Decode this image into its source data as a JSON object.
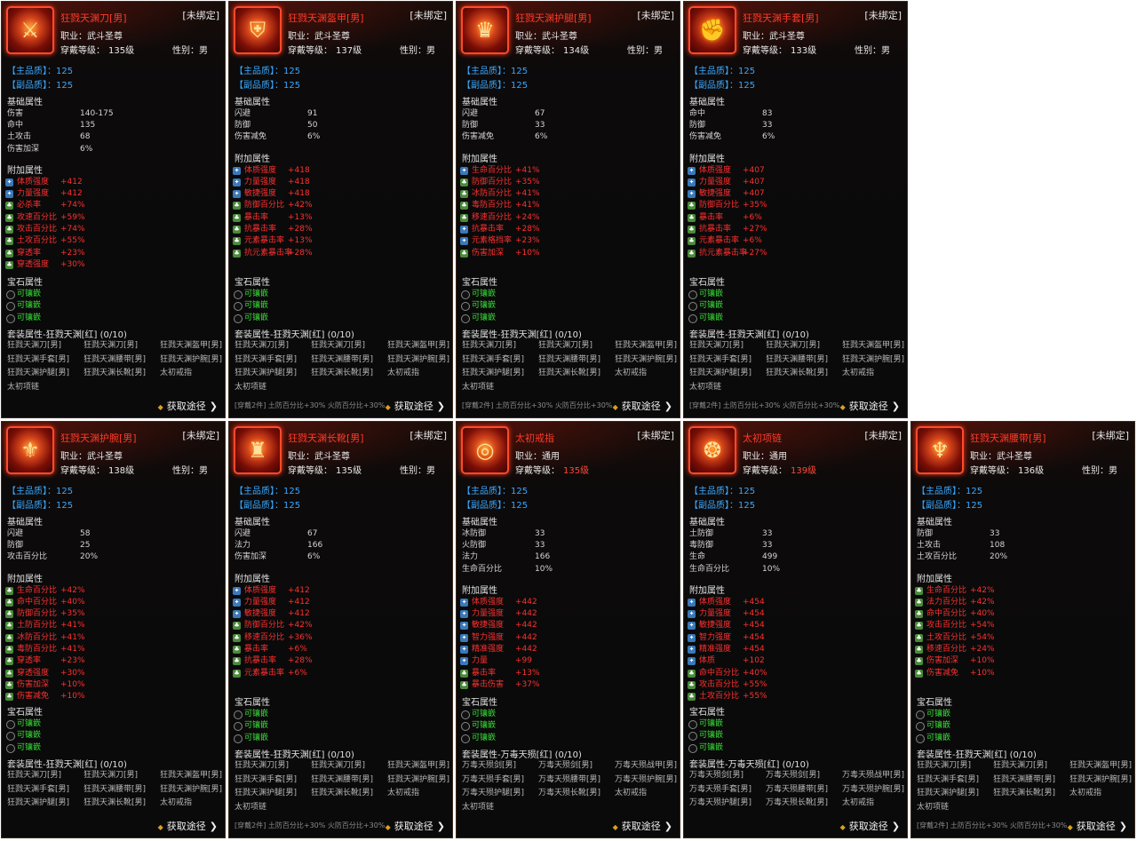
{
  "ui": {
    "unbound": "[未绑定]",
    "job_prefix": "职业：",
    "level_prefix": "穿戴等级：",
    "sex_prefix": "性别：",
    "main_quality_prefix": "【主品质】：",
    "sub_quality_prefix": "【副品质】：",
    "base_title": "基础属性",
    "add_title": "附加属性",
    "gem_title": "宝石属性",
    "gem_slot": "可镶嵌",
    "get_label": "获取途径"
  },
  "cards": [
    {
      "name": "狂戮天渊刀[男]",
      "job": "武斗圣尊",
      "level": "135级",
      "level_red": false,
      "sex": "男",
      "main_q": "125",
      "sub_q": "125",
      "icon": "sword-icon",
      "glyph": "⚔",
      "base": [
        {
          "k": "伤害",
          "v": "140-175"
        },
        {
          "k": "命中",
          "v": "135"
        },
        {
          "k": "土攻击",
          "v": "68"
        },
        {
          "k": "伤害加深",
          "v": "6%"
        }
      ],
      "add": [
        {
          "k": "体质强度",
          "v": "+412",
          "c": "blue"
        },
        {
          "k": "力量强度",
          "v": "+412",
          "c": "blue"
        },
        {
          "k": "必杀率",
          "v": "+74%",
          "c": "green"
        },
        {
          "k": "攻速百分比",
          "v": "+59%",
          "c": "green"
        },
        {
          "k": "攻击百分比",
          "v": "+74%",
          "c": "green"
        },
        {
          "k": "土攻百分比",
          "v": "+55%",
          "c": "green"
        },
        {
          "k": "穿透率",
          "v": "+23%",
          "c": "green"
        },
        {
          "k": "穿透强度",
          "v": "+30%",
          "c": "green"
        }
      ],
      "set_title": "套装属性-狂戮天渊[红] (0/10)",
      "set": [
        [
          "狂戮天渊刀[男]",
          "狂戮天渊刀[男]",
          "狂戮天渊盔甲[男]"
        ],
        [
          "狂戮天渊手套[男]",
          "狂戮天渊腰带[男]",
          "狂戮天渊护腕[男]"
        ],
        [
          "狂戮天渊护腿[男]",
          "狂戮天渊长靴[男]",
          "太初戒指"
        ],
        [
          "太初项链"
        ]
      ],
      "foot": ""
    },
    {
      "name": "狂戮天渊盔甲[男]",
      "job": "武斗圣尊",
      "level": "137级",
      "level_red": false,
      "sex": "男",
      "main_q": "125",
      "sub_q": "125",
      "icon": "armor-icon",
      "glyph": "⛨",
      "base": [
        {
          "k": "闪避",
          "v": "91"
        },
        {
          "k": "防御",
          "v": "50"
        },
        {
          "k": "伤害减免",
          "v": "6%"
        }
      ],
      "add": [
        {
          "k": "体质强度",
          "v": "+418",
          "c": "blue"
        },
        {
          "k": "力量强度",
          "v": "+418",
          "c": "blue"
        },
        {
          "k": "敏捷强度",
          "v": "+418",
          "c": "blue"
        },
        {
          "k": "防御百分比",
          "v": "+42%",
          "c": "green"
        },
        {
          "k": "暴击率",
          "v": "+13%",
          "c": "green"
        },
        {
          "k": "抗暴击率",
          "v": "+28%",
          "c": "green"
        },
        {
          "k": "元素暴击率",
          "v": "+13%",
          "c": "green"
        },
        {
          "k": "抗元素暴击率",
          "v": "+28%",
          "c": "green"
        }
      ],
      "set_title": "套装属性-狂戮天渊[红] (0/10)",
      "set": [
        [
          "狂戮天渊刀[男]",
          "狂戮天渊刀[男]",
          "狂戮天渊盔甲[男]"
        ],
        [
          "狂戮天渊手套[男]",
          "狂戮天渊腰带[男]",
          "狂戮天渊护腕[男]"
        ],
        [
          "狂戮天渊护腿[男]",
          "狂戮天渊长靴[男]",
          "太初戒指"
        ],
        [
          "太初项链"
        ]
      ],
      "foot": "[穿戴2件]  土防百分比+30%    火防百分比+30%"
    },
    {
      "name": "狂戮天渊护腿[男]",
      "job": "武斗圣尊",
      "level": "134级",
      "level_red": false,
      "sex": "男",
      "main_q": "125",
      "sub_q": "125",
      "icon": "greaves-icon",
      "glyph": "♛",
      "base": [
        {
          "k": "闪避",
          "v": "67"
        },
        {
          "k": "防御",
          "v": "33"
        },
        {
          "k": "伤害减免",
          "v": "6%"
        }
      ],
      "add": [
        {
          "k": "生命百分比",
          "v": "+41%",
          "c": "blue"
        },
        {
          "k": "防御百分比",
          "v": "+35%",
          "c": "green"
        },
        {
          "k": "冰防百分比",
          "v": "+41%",
          "c": "green"
        },
        {
          "k": "毒防百分比",
          "v": "+41%",
          "c": "green"
        },
        {
          "k": "移速百分比",
          "v": "+24%",
          "c": "green"
        },
        {
          "k": "抗暴击率",
          "v": "+28%",
          "c": "blue"
        },
        {
          "k": "元素格挡率",
          "v": "+23%",
          "c": "blue"
        },
        {
          "k": "伤害加深",
          "v": "+10%",
          "c": "green"
        }
      ],
      "set_title": "套装属性-狂戮天渊[红] (0/10)",
      "set": [
        [
          "狂戮天渊刀[男]",
          "狂戮天渊刀[男]",
          "狂戮天渊盔甲[男]"
        ],
        [
          "狂戮天渊手套[男]",
          "狂戮天渊腰带[男]",
          "狂戮天渊护腕[男]"
        ],
        [
          "狂戮天渊护腿[男]",
          "狂戮天渊长靴[男]",
          "太初戒指"
        ],
        [
          "太初项链"
        ]
      ],
      "foot": "[穿戴2件]  土防百分比+30%    火防百分比+30%"
    },
    {
      "name": "狂戮天渊手套[男]",
      "job": "武斗圣尊",
      "level": "133级",
      "level_red": false,
      "sex": "男",
      "main_q": "125",
      "sub_q": "125",
      "icon": "gauntlet-icon",
      "glyph": "✊",
      "base": [
        {
          "k": "命中",
          "v": "83"
        },
        {
          "k": "防御",
          "v": "33"
        },
        {
          "k": "伤害减免",
          "v": "6%"
        }
      ],
      "add": [
        {
          "k": "体质强度",
          "v": "+407",
          "c": "blue"
        },
        {
          "k": "力量强度",
          "v": "+407",
          "c": "blue"
        },
        {
          "k": "敏捷强度",
          "v": "+407",
          "c": "blue"
        },
        {
          "k": "防御百分比",
          "v": "+35%",
          "c": "green"
        },
        {
          "k": "暴击率",
          "v": "+6%",
          "c": "green"
        },
        {
          "k": "抗暴击率",
          "v": "+27%",
          "c": "green"
        },
        {
          "k": "元素暴击率",
          "v": "+6%",
          "c": "green"
        },
        {
          "k": "抗元素暴击率",
          "v": "+27%",
          "c": "green"
        }
      ],
      "set_title": "套装属性-狂戮天渊[红] (0/10)",
      "set": [
        [
          "狂戮天渊刀[男]",
          "狂戮天渊刀[男]",
          "狂戮天渊盔甲[男]"
        ],
        [
          "狂戮天渊手套[男]",
          "狂戮天渊腰带[男]",
          "狂戮天渊护腕[男]"
        ],
        [
          "狂戮天渊护腿[男]",
          "狂戮天渊长靴[男]",
          "太初戒指"
        ],
        [
          "太初项链"
        ]
      ],
      "foot": "[穿戴2件]  土防百分比+30%    火防百分比+30%"
    },
    {
      "name": "狂戮天渊护腕[男]",
      "job": "武斗圣尊",
      "level": "138级",
      "level_red": false,
      "sex": "男",
      "main_q": "125",
      "sub_q": "125",
      "icon": "bracer-icon",
      "glyph": "⚜",
      "base": [
        {
          "k": "闪避",
          "v": "58"
        },
        {
          "k": "防御",
          "v": "25"
        },
        {
          "k": "攻击百分比",
          "v": "20%"
        }
      ],
      "add": [
        {
          "k": "生命百分比",
          "v": "+42%",
          "c": "green"
        },
        {
          "k": "命中百分比",
          "v": "+40%",
          "c": "green"
        },
        {
          "k": "防御百分比",
          "v": "+35%",
          "c": "green"
        },
        {
          "k": "土防百分比",
          "v": "+41%",
          "c": "green"
        },
        {
          "k": "冰防百分比",
          "v": "+41%",
          "c": "green"
        },
        {
          "k": "毒防百分比",
          "v": "+41%",
          "c": "green"
        },
        {
          "k": "穿透率",
          "v": "+23%",
          "c": "green"
        },
        {
          "k": "穿透强度",
          "v": "+30%",
          "c": "green"
        },
        {
          "k": "伤害加深",
          "v": "+10%",
          "c": "green"
        },
        {
          "k": "伤害减免",
          "v": "+10%",
          "c": "green"
        }
      ],
      "set_title": "套装属性-狂戮天渊[红] (0/10)",
      "set": [
        [
          "狂戮天渊刀[男]",
          "狂戮天渊刀[男]",
          "狂戮天渊盔甲[男]"
        ],
        [
          "狂戮天渊手套[男]",
          "狂戮天渊腰带[男]",
          "狂戮天渊护腕[男]"
        ],
        [
          "狂戮天渊护腿[男]",
          "狂戮天渊长靴[男]",
          "太初戒指"
        ]
      ],
      "foot": ""
    },
    {
      "name": "狂戮天渊长靴[男]",
      "job": "武斗圣尊",
      "level": "135级",
      "level_red": false,
      "sex": "男",
      "main_q": "125",
      "sub_q": "125",
      "icon": "boots-icon",
      "glyph": "♜",
      "base": [
        {
          "k": "闪避",
          "v": "67"
        },
        {
          "k": "法力",
          "v": "166"
        },
        {
          "k": "伤害加深",
          "v": "6%"
        }
      ],
      "add": [
        {
          "k": "体质强度",
          "v": "+412",
          "c": "blue"
        },
        {
          "k": "力量强度",
          "v": "+412",
          "c": "blue"
        },
        {
          "k": "敏捷强度",
          "v": "+412",
          "c": "blue"
        },
        {
          "k": "防御百分比",
          "v": "+42%",
          "c": "green"
        },
        {
          "k": "移速百分比",
          "v": "+36%",
          "c": "green"
        },
        {
          "k": "暴击率",
          "v": "+6%",
          "c": "green"
        },
        {
          "k": "抗暴击率",
          "v": "+28%",
          "c": "green"
        },
        {
          "k": "元素暴击率",
          "v": "+6%",
          "c": "green"
        }
      ],
      "set_title": "套装属性-狂戮天渊[红] (0/10)",
      "set": [
        [
          "狂戮天渊刀[男]",
          "狂戮天渊刀[男]",
          "狂戮天渊盔甲[男]"
        ],
        [
          "狂戮天渊手套[男]",
          "狂戮天渊腰带[男]",
          "狂戮天渊护腕[男]"
        ],
        [
          "狂戮天渊护腿[男]",
          "狂戮天渊长靴[男]",
          "太初戒指"
        ],
        [
          "太初项链"
        ]
      ],
      "foot": "[穿戴2件]  土防百分比+30%    火防百分比+30%"
    },
    {
      "name": "太初戒指",
      "job": "通用",
      "level": "135级",
      "level_red": true,
      "sex": "",
      "main_q": "125",
      "sub_q": "125",
      "icon": "ring-icon",
      "glyph": "◎",
      "base": [
        {
          "k": "冰防御",
          "v": "33"
        },
        {
          "k": "火防御",
          "v": "33"
        },
        {
          "k": "法力",
          "v": "166"
        },
        {
          "k": "生命百分比",
          "v": "10%"
        }
      ],
      "add": [
        {
          "k": "体质强度",
          "v": "+442",
          "c": "blue"
        },
        {
          "k": "力量强度",
          "v": "+442",
          "c": "blue"
        },
        {
          "k": "敏捷强度",
          "v": "+442",
          "c": "blue"
        },
        {
          "k": "智力强度",
          "v": "+442",
          "c": "blue"
        },
        {
          "k": "精准强度",
          "v": "+442",
          "c": "blue"
        },
        {
          "k": "力量",
          "v": "+99",
          "c": "blue"
        },
        {
          "k": "暴击率",
          "v": "+13%",
          "c": "green"
        },
        {
          "k": "暴击伤害",
          "v": "+37%",
          "c": "green"
        }
      ],
      "set_title": "套装属性-万毒天殒[红] (0/10)",
      "set": [
        [
          "万毒天殒剑[男]",
          "万毒天殒剑[男]",
          "万毒天殒战甲[男]"
        ],
        [
          "万毒天殒手套[男]",
          "万毒天殒腰带[男]",
          "万毒天殒护腕[男]"
        ],
        [
          "万毒天殒护腿[男]",
          "万毒天殒长靴[男]",
          "太初戒指"
        ],
        [
          "太初项链"
        ]
      ],
      "foot": ""
    },
    {
      "name": "太初项链",
      "job": "通用",
      "level": "139级",
      "level_red": true,
      "sex": "",
      "main_q": "125",
      "sub_q": "125",
      "icon": "necklace-icon",
      "glyph": "❂",
      "base": [
        {
          "k": "土防御",
          "v": "33"
        },
        {
          "k": "毒防御",
          "v": "33"
        },
        {
          "k": "生命",
          "v": "499"
        },
        {
          "k": "生命百分比",
          "v": "10%"
        }
      ],
      "add": [
        {
          "k": "体质强度",
          "v": "+454",
          "c": "blue"
        },
        {
          "k": "力量强度",
          "v": "+454",
          "c": "blue"
        },
        {
          "k": "敏捷强度",
          "v": "+454",
          "c": "blue"
        },
        {
          "k": "智力强度",
          "v": "+454",
          "c": "blue"
        },
        {
          "k": "精准强度",
          "v": "+454",
          "c": "blue"
        },
        {
          "k": "体质",
          "v": "+102",
          "c": "blue"
        },
        {
          "k": "命中百分比",
          "v": "+40%",
          "c": "green"
        },
        {
          "k": "攻击百分比",
          "v": "+55%",
          "c": "green"
        },
        {
          "k": "土攻百分比",
          "v": "+55%",
          "c": "green"
        }
      ],
      "set_title": "套装属性-万毒天殒[红] (0/10)",
      "set": [
        [
          "万毒天殒剑[男]",
          "万毒天殒剑[男]",
          "万毒天殒战甲[男]"
        ],
        [
          "万毒天殒手套[男]",
          "万毒天殒腰带[男]",
          "万毒天殒护腕[男]"
        ],
        [
          "万毒天殒护腿[男]",
          "万毒天殒长靴[男]",
          "太初戒指"
        ]
      ],
      "foot": ""
    },
    {
      "name": "狂戮天渊腰带[男]",
      "job": "武斗圣尊",
      "level": "136级",
      "level_red": false,
      "sex": "男",
      "main_q": "125",
      "sub_q": "125",
      "icon": "belt-icon",
      "glyph": "♆",
      "base": [
        {
          "k": "防御",
          "v": "33"
        },
        {
          "k": "土攻击",
          "v": "108"
        },
        {
          "k": "土攻百分比",
          "v": "20%"
        }
      ],
      "add": [
        {
          "k": "生命百分比",
          "v": "+42%",
          "c": "green"
        },
        {
          "k": "法力百分比",
          "v": "+42%",
          "c": "green"
        },
        {
          "k": "命中百分比",
          "v": "+40%",
          "c": "green"
        },
        {
          "k": "攻击百分比",
          "v": "+54%",
          "c": "green"
        },
        {
          "k": "土攻百分比",
          "v": "+54%",
          "c": "green"
        },
        {
          "k": "移速百分比",
          "v": "+24%",
          "c": "green"
        },
        {
          "k": "伤害加深",
          "v": "+10%",
          "c": "green"
        },
        {
          "k": "伤害减免",
          "v": "+10%",
          "c": "green"
        }
      ],
      "set_title": "套装属性-狂戮天渊[红] (0/10)",
      "set": [
        [
          "狂戮天渊刀[男]",
          "狂戮天渊刀[男]",
          "狂戮天渊盔甲[男]"
        ],
        [
          "狂戮天渊手套[男]",
          "狂戮天渊腰带[男]",
          "狂戮天渊护腕[男]"
        ],
        [
          "狂戮天渊护腿[男]",
          "狂戮天渊长靴[男]",
          "太初戒指"
        ],
        [
          "太初项链"
        ]
      ],
      "foot": "[穿戴2件]  土防百分比+30%    火防百分比+30%"
    }
  ]
}
